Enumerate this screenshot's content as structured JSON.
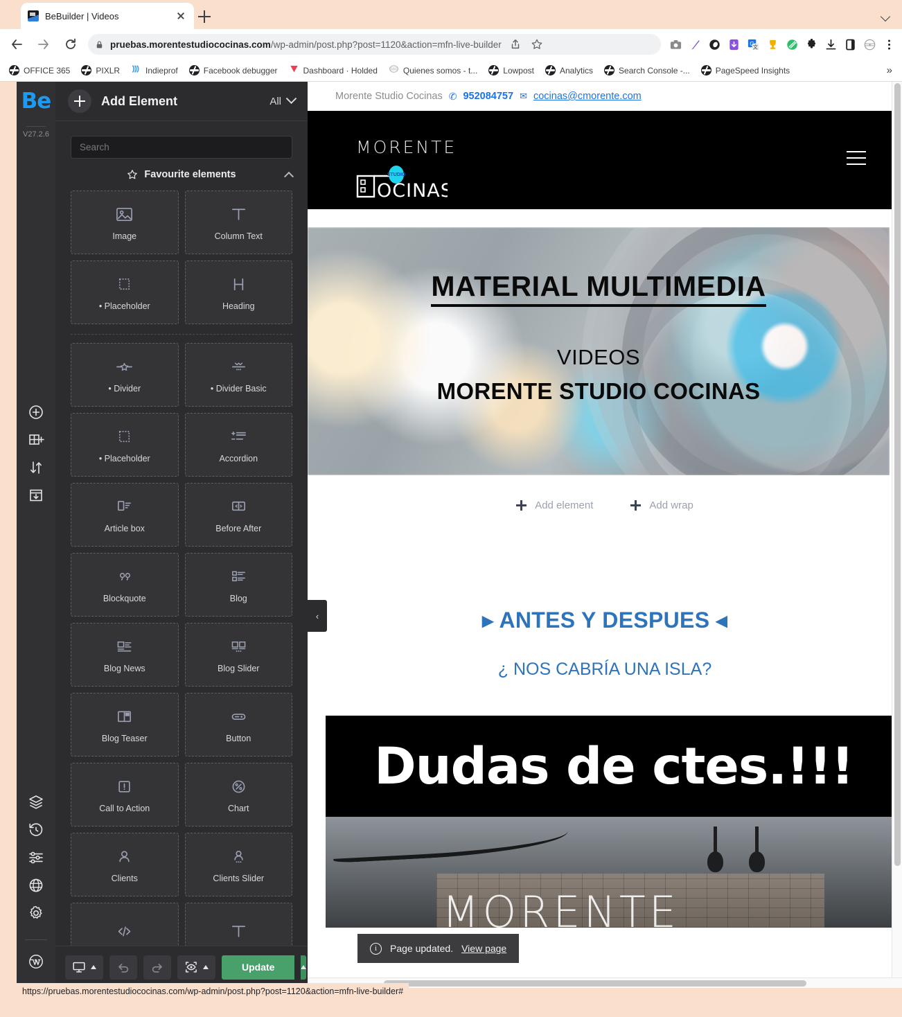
{
  "browser": {
    "tab": {
      "title": "BeBuilder | Videos",
      "favicon": "bebuilder-favicon",
      "close": "×",
      "newtab": "+"
    },
    "window_controls": {
      "minimize": "chevron-down-icon"
    },
    "nav": {
      "back": "back-arrow-icon",
      "forward": "forward-arrow-icon",
      "reload": "reload-icon"
    },
    "omnibox": {
      "lock": "lock-icon",
      "url_bold": "pruebas.morentestudiococinas.com",
      "url_path": "/wp-admin/post.php?post=1120&action=mfn-live-builder",
      "share": "share-icon",
      "bookmark": "star-icon"
    },
    "extensions": [
      {
        "name": "screenshot-extension-icon",
        "glyph": "▣",
        "color": "#8a8a8a"
      },
      {
        "name": "pen-extension-icon",
        "glyph": "/",
        "color": "#8457c9"
      },
      {
        "name": "moon-extension-icon",
        "glyph": "●",
        "color": "#232323"
      },
      {
        "name": "download-purple-extension-icon",
        "glyph": "▼",
        "color": "#8d4fe0"
      },
      {
        "name": "google-translate-extension-icon",
        "glyph": "G",
        "color": "#1a73e8"
      },
      {
        "name": "trophy-extension-icon",
        "glyph": "★",
        "color": "#f0b000"
      },
      {
        "name": "green-slash-extension-icon",
        "glyph": "⊘",
        "color": "#2bbf6a"
      },
      {
        "name": "puzzle-extensions-icon",
        "glyph": "✦",
        "color": "#202124"
      },
      {
        "name": "downloads-icon",
        "glyph": "⭳",
        "color": "#202124"
      },
      {
        "name": "sidepanel-icon",
        "glyph": "▯",
        "color": "#202124"
      },
      {
        "name": "profile-avatar-icon",
        "glyph": "◍",
        "color": "#9b9b9b"
      },
      {
        "name": "chrome-menu-icon",
        "glyph": "⋮",
        "color": "#202124"
      }
    ],
    "bookmarks": [
      {
        "label": "OFFICE 365",
        "icon": "globe-icon"
      },
      {
        "label": "PIXLR",
        "icon": "globe-icon"
      },
      {
        "label": "Indieprof",
        "icon": "waves-icon"
      },
      {
        "label": "Facebook debugger",
        "icon": "globe-icon"
      },
      {
        "label": "Dashboard · Holded",
        "icon": "holded-icon"
      },
      {
        "label": "Quienes somos - t...",
        "icon": "seal-icon"
      },
      {
        "label": "Lowpost",
        "icon": "globe-icon"
      },
      {
        "label": "Analytics",
        "icon": "globe-icon"
      },
      {
        "label": "Search Console -...",
        "icon": "globe-icon"
      },
      {
        "label": "PageSpeed Insights",
        "icon": "globe-icon"
      }
    ],
    "bookmarks_overflow": "»",
    "status_url": "https://pruebas.morentestudiococinas.com/wp-admin/post.php?post=1120&action=mfn-live-builder#"
  },
  "builder": {
    "brand": "Be",
    "version": "V27.2.6",
    "rail_top_icons": [
      {
        "name": "add-section-icon"
      },
      {
        "name": "add-column-icon"
      },
      {
        "name": "reorder-icon"
      },
      {
        "name": "add-template-icon"
      }
    ],
    "rail_bottom_icons": [
      {
        "name": "layers-icon"
      },
      {
        "name": "history-icon"
      },
      {
        "name": "sliders-icon"
      },
      {
        "name": "globe-icon"
      },
      {
        "name": "settings-gear-icon"
      },
      {
        "name": "wordpress-icon"
      }
    ],
    "panel": {
      "add_button": "add-element-plus-button",
      "title": "Add Element",
      "filter_label": "All",
      "filter_chevron": "chevron-down-icon",
      "search_placeholder": "Search",
      "search_value": "",
      "group": {
        "label": "Favourite elements",
        "icon": "star-icon",
        "collapse": "chevron-up-icon"
      },
      "favourites": [
        {
          "label": "Image",
          "icon": "image-icon"
        },
        {
          "label": "Column Text",
          "icon": "text-t-icon"
        },
        {
          "label": "• Placeholder",
          "icon": "placeholder-icon"
        },
        {
          "label": "Heading",
          "icon": "heading-h-icon"
        }
      ],
      "elements": [
        {
          "label": "• Divider",
          "icon": "divider-star-icon"
        },
        {
          "label": "• Divider Basic",
          "icon": "divider-basic-icon"
        },
        {
          "label": "• Placeholder",
          "icon": "placeholder-icon"
        },
        {
          "label": "Accordion",
          "icon": "accordion-icon"
        },
        {
          "label": "Article box",
          "icon": "article-box-icon"
        },
        {
          "label": "Before After",
          "icon": "before-after-icon"
        },
        {
          "label": "Blockquote",
          "icon": "quote-icon"
        },
        {
          "label": "Blog",
          "icon": "blog-icon"
        },
        {
          "label": "Blog News",
          "icon": "blog-news-icon"
        },
        {
          "label": "Blog Slider",
          "icon": "blog-slider-icon"
        },
        {
          "label": "Blog Teaser",
          "icon": "blog-teaser-icon"
        },
        {
          "label": "Button",
          "icon": "button-icon"
        },
        {
          "label": "Call to Action",
          "icon": "call-to-action-icon"
        },
        {
          "label": "Chart",
          "icon": "chart-icon"
        },
        {
          "label": "Clients",
          "icon": "clients-icon"
        },
        {
          "label": "Clients Slider",
          "icon": "clients-slider-icon"
        },
        {
          "label": "",
          "icon": "code-icon"
        },
        {
          "label": "",
          "icon": "text-t-icon"
        }
      ]
    },
    "footer": {
      "responsive": {
        "name": "desktop-view-button",
        "icon": "monitor-icon",
        "caret": "caret-up-icon"
      },
      "undo": {
        "name": "undo-button",
        "icon": "undo-icon"
      },
      "redo": {
        "name": "redo-button",
        "icon": "redo-icon"
      },
      "preview": {
        "name": "preview-button",
        "icon": "eye-focus-icon",
        "caret": "caret-up-icon"
      },
      "update_label": "Update",
      "update_caret": "caret-up-icon"
    },
    "collapse_handle": "‹"
  },
  "page": {
    "topbar": {
      "company": "Morente Studio Cocinas",
      "phone_icon": "phone-icon",
      "phone": "952084757",
      "mail_icon": "envelope-icon",
      "email": "cocinas@cmorente.com"
    },
    "header": {
      "brand_word": "MORENTE",
      "logo_text": "COCINAS",
      "logo_badge": "STUDIO",
      "menu": "hamburger-menu-icon"
    },
    "hero": {
      "title": "MATERIAL MULTIMEDIA",
      "subtitle": "VIDEOS",
      "brand": "MORENTE STUDIO COCINAS"
    },
    "builder_actions": {
      "add_element": "Add element",
      "add_wrap": "Add wrap"
    },
    "section_antes": {
      "heading": "▸ ANTES Y DESPUES ◂",
      "subheading": "¿ NOS CABRÍA UNA ISLA?"
    },
    "video": {
      "caption": "Dudas de ctes.!!!",
      "photo_word": "MORENTE"
    },
    "toast": {
      "icon": "info-icon",
      "message": "Page updated.",
      "link": "View page"
    }
  },
  "colors": {
    "accent_blue": "#1a73e8",
    "brand_be_blue": "#1e9bf0",
    "update_green": "#48a06b",
    "panel_bg": "#2c2c2e",
    "site_link_blue": "#2e74ba"
  }
}
